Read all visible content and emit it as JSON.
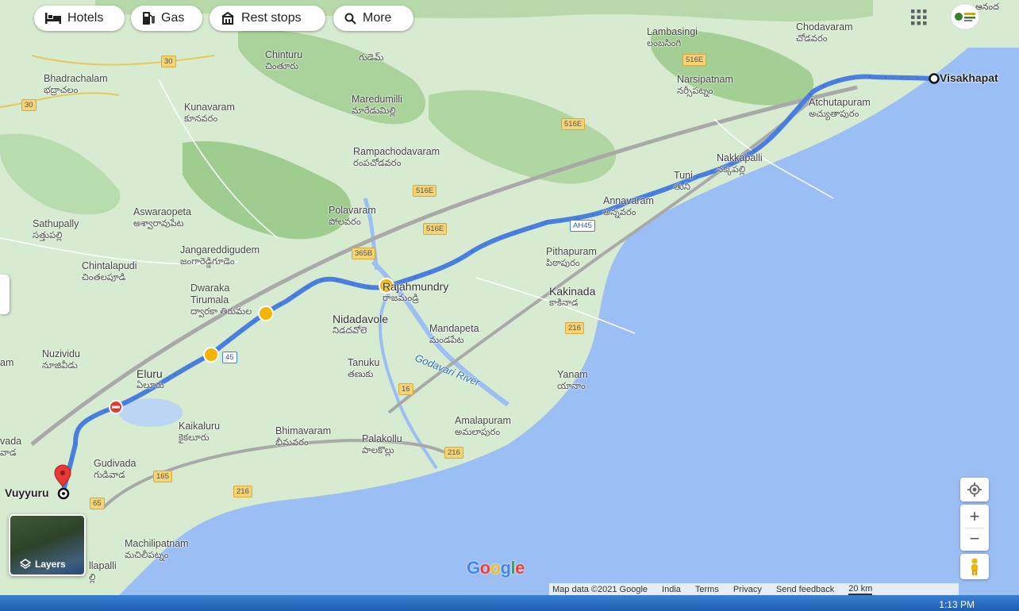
{
  "chips": [
    {
      "label": "Hotels",
      "icon": "bed-icon"
    },
    {
      "label": "Gas",
      "icon": "gas-pump-icon"
    },
    {
      "label": "Rest stops",
      "icon": "rest-stop-icon"
    },
    {
      "label": "More",
      "icon": "search-icon"
    }
  ],
  "route": {
    "origin": "Vuyyuru",
    "destination": "Visakhapat"
  },
  "places": [
    {
      "id": "chodavaram",
      "en": "Chodavaram",
      "te": "చోడవరం"
    },
    {
      "id": "lambasingi",
      "en": "Lambasingi",
      "te": "లంబసింగి"
    },
    {
      "id": "chinturu",
      "en": "Chinturu",
      "te": "చింతూరు"
    },
    {
      "id": "gudem",
      "te": "గుడెమ్"
    },
    {
      "id": "bhadrachalam",
      "en": "Bhadrachalam",
      "te": "భద్రాచలం"
    },
    {
      "id": "kunavaram",
      "en": "Kunavaram",
      "te": "కూనవరం"
    },
    {
      "id": "maredumilli",
      "en": "Maredumilli",
      "te": "మారేడుమిల్లి"
    },
    {
      "id": "narsipatnam",
      "en": "Narsipatnam",
      "te": "నర్సీపట్నం"
    },
    {
      "id": "atchutapuram",
      "en": "Atchutapuram",
      "te": "అచ్యుతాపురం"
    },
    {
      "id": "rampachodavaram",
      "en": "Rampachodavaram",
      "te": "రంపచోడవరం"
    },
    {
      "id": "nakkapalli",
      "en": "Nakkapalli",
      "te": "నక్కపల్లి"
    },
    {
      "id": "tuni",
      "en": "Tuni",
      "te": "తుని"
    },
    {
      "id": "annavaram",
      "en": "Annavaram",
      "te": "అన్నవరం"
    },
    {
      "id": "aswaraopeta",
      "en": "Aswaraopeta",
      "te": "అశ్వారావుపేట"
    },
    {
      "id": "polavaram",
      "en": "Polavaram",
      "te": "పోలవరం"
    },
    {
      "id": "sathupally",
      "en": "Sathupally",
      "te": "సత్తుపల్లి"
    },
    {
      "id": "jangareddigudem",
      "en": "Jangareddigudem",
      "te": "జంగారెడ్డిగూడెం"
    },
    {
      "id": "pithapuram",
      "en": "Pithapuram",
      "te": "పిఠాపురం"
    },
    {
      "id": "chintalapudi",
      "en": "Chintalapudi",
      "te": "చింతలపూడి"
    },
    {
      "id": "rajahmundry",
      "en": "Rajahmundry",
      "te": "రాజమండ్రి"
    },
    {
      "id": "kakinada",
      "en": "Kakinada",
      "te": "కాకినాడ"
    },
    {
      "id": "dwaraka",
      "en": "Dwaraka",
      "te": ""
    },
    {
      "id": "tirumala",
      "en": "Tirumala",
      "te": "ద్వారకా తిరుమల"
    },
    {
      "id": "nidadavole",
      "en": "Nidadavole",
      "te": "నిడదవోలె"
    },
    {
      "id": "mandapeta",
      "en": "Mandapeta",
      "te": "మండపేట"
    },
    {
      "id": "nuzvid",
      "en": "Nuzividu",
      "te": "నూజివీడు"
    },
    {
      "id": "tanuku",
      "en": "Tanuku",
      "te": "తణుకు"
    },
    {
      "id": "yanam",
      "en": "Yanam",
      "te": "యానాం"
    },
    {
      "id": "eluru",
      "en": "Eluru",
      "te": "ఏలూరు"
    },
    {
      "id": "amalapuram",
      "en": "Amalapuram",
      "te": "అమలాపురం"
    },
    {
      "id": "kaikaluru",
      "en": "Kaikaluru",
      "te": "కైకలూరు"
    },
    {
      "id": "bhimavaram",
      "en": "Bhimavaram",
      "te": "భీమవరం"
    },
    {
      "id": "palakollu",
      "en": "Palakollu",
      "te": "పాలకొల్లు"
    },
    {
      "id": "vada",
      "en": "vada",
      "te": "వాడ"
    },
    {
      "id": "gudivada",
      "en": "Gudivada",
      "te": "గుడివాడ"
    },
    {
      "id": "machilipatnam",
      "en": "Machilipatnam",
      "te": "మచిలీపట్నం"
    },
    {
      "id": "llapalli",
      "en": "llapalli",
      "te": "ల్లి"
    },
    {
      "id": "am",
      "en": "am",
      "te": ""
    },
    {
      "id": "topright",
      "te": "ఆనంద"
    }
  ],
  "river": "Godavari River",
  "shields": [
    "30",
    "30",
    "516E",
    "516E",
    "516E",
    "516E",
    "365B",
    "AH45",
    "45",
    "216",
    "16",
    "216",
    "165",
    "216",
    "65"
  ],
  "layers_label": "Layers",
  "google_logo": "Google",
  "footer": [
    "Map data ©2021 Google",
    "India",
    "Terms",
    "Privacy",
    "Send feedback",
    "20 km"
  ],
  "zoom": {
    "in": "+",
    "out": "−"
  },
  "clock": "1:13 PM",
  "colors": {
    "route": "#4a7fe0",
    "water": "#9bbff5",
    "land": "#cfe8c8",
    "forest": "#a6cf9a"
  }
}
